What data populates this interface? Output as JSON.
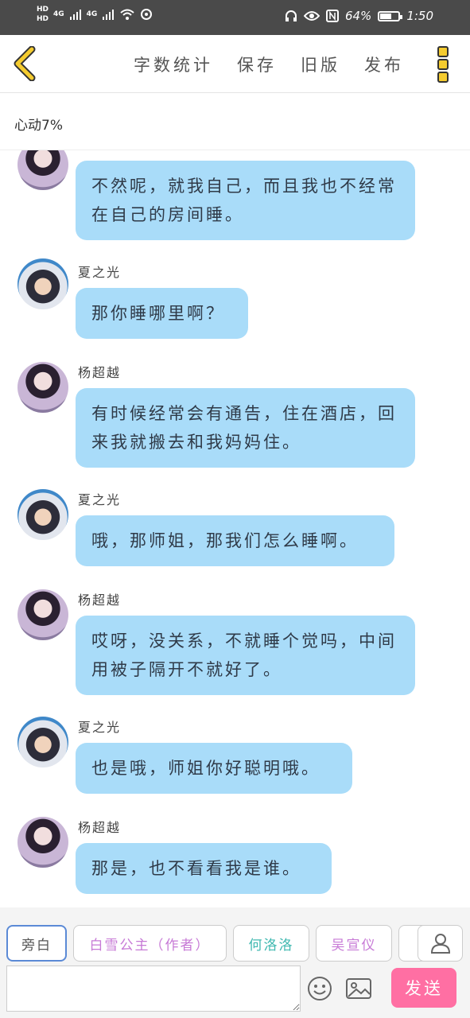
{
  "status_bar": {
    "hd1": "HD",
    "hd2": "HD",
    "net1": "4G",
    "net2": "4G",
    "battery_percent_text": "64%",
    "battery_level": 0.64,
    "time": "1:50"
  },
  "nav": {
    "back_icon": "chevron-left-icon",
    "word_count": "字数统计",
    "save": "保存",
    "old_version": "旧版",
    "publish": "发布",
    "more_icon": "more-vertical-icon"
  },
  "subtitle": "心动7%",
  "messages": [
    {
      "speaker": "",
      "avatar": "yang",
      "text": "不然呢，就我自己，而且我也不经常在自己的房间睡。"
    },
    {
      "speaker": "夏之光",
      "avatar": "xia",
      "text": "那你睡哪里啊？"
    },
    {
      "speaker": "杨超越",
      "avatar": "yang",
      "text": "有时候经常会有通告，住在酒店，回来我就搬去和我妈妈住。"
    },
    {
      "speaker": "夏之光",
      "avatar": "xia",
      "text": "哦，那师姐，那我们怎么睡啊。"
    },
    {
      "speaker": "杨超越",
      "avatar": "yang",
      "text": "哎呀，没关系，不就睡个觉吗，中间用被子隔开不就好了。"
    },
    {
      "speaker": "夏之光",
      "avatar": "xia",
      "text": "也是哦，师姐你好聪明哦。"
    },
    {
      "speaker": "杨超越",
      "avatar": "yang",
      "text": "那是，也不看看我是谁。"
    }
  ],
  "characters": [
    {
      "label": "旁白",
      "color": "#555555"
    },
    {
      "label": "白雪公主（作者）",
      "color": "#c77ad6"
    },
    {
      "label": "何洛洛",
      "color": "#3fb8b0"
    },
    {
      "label": "吴宣仪",
      "color": "#c77ad6"
    },
    {
      "label": "",
      "color": "#e05050"
    }
  ],
  "input": {
    "placeholder": "",
    "value": ""
  },
  "send_label": "发送",
  "icons": {
    "add_role": "person-icon",
    "emoji": "emoji-icon",
    "image": "image-icon"
  }
}
